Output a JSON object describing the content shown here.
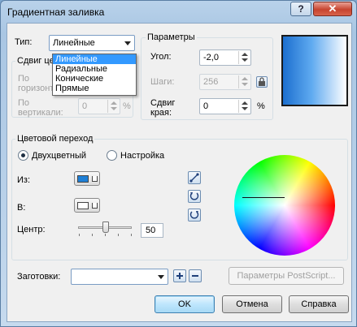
{
  "window": {
    "title": "Градиентная заливка",
    "help_label": "?",
    "close_label": "✕"
  },
  "type": {
    "label": "Тип:",
    "selected": "Линейные",
    "options": [
      "Линейные",
      "Радиальные",
      "Конические",
      "Прямые"
    ],
    "highlighted_index": 0
  },
  "center_offset": {
    "title": "Сдвиг центра",
    "horizontal_label": "По горизонтали:",
    "vertical_label": "По вертикали:",
    "vertical_value": "0",
    "percent": "%"
  },
  "params": {
    "title": "Параметры",
    "angle_label": "Угол:",
    "angle_value": "-2,0",
    "steps_label": "Шаги:",
    "steps_value": "256",
    "edge_label_1": "Сдвиг",
    "edge_label_2": "края:",
    "edge_value": "0",
    "percent": "%"
  },
  "blend": {
    "title": "Цветовой переход",
    "two_color_label": "Двухцветный",
    "custom_label": "Настройка",
    "from_label": "Из:",
    "to_label": "В:",
    "center_label": "Центр:",
    "center_value": "50",
    "center_fraction": 0.5
  },
  "presets": {
    "label": "Заготовки:",
    "value": ""
  },
  "buttons": {
    "postscript": "Параметры PostScript...",
    "ok": "OK",
    "cancel": "Отмена",
    "help": "Справка"
  },
  "colors": {
    "from_swatch": "#1e7fd6",
    "to_swatch": "#ffffff",
    "gradient_start": "#1c6fcf",
    "gradient_end": "#ffffff",
    "selection": "#3399ff"
  },
  "icons": {
    "lock": "lock-icon",
    "direct_path": "line-path-icon",
    "ccw_path": "counterclockwise-path-icon",
    "cw_path": "clockwise-path-icon",
    "add_preset": "plus-icon",
    "remove_preset": "minus-icon"
  }
}
